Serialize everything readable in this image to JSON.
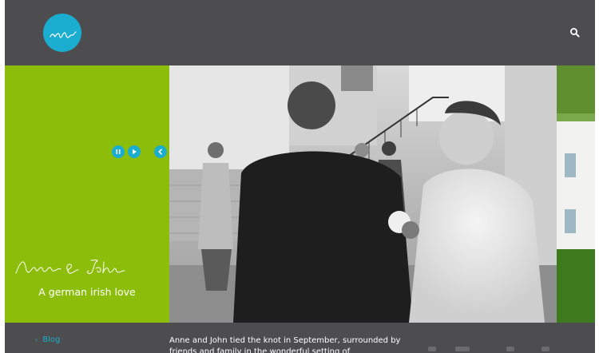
{
  "header": {
    "logo_icon": "wave-script-logo",
    "search_icon": "search-icon"
  },
  "slider": {
    "controls": [
      "pause-icon",
      "play-icon",
      "prev-icon",
      "next-icon"
    ],
    "caption_script": "Anne & John",
    "caption_subtitle": "A german irish love"
  },
  "footer": {
    "nav_blog": "Blog",
    "post_excerpt": "Anne and John tied the knot in September, surrounded by friends and family in the wonderful setting of"
  },
  "colors": {
    "header_bg": "#4d4d4f",
    "accent_blue": "#1badcf",
    "caption_green": "#8cbd0a"
  }
}
